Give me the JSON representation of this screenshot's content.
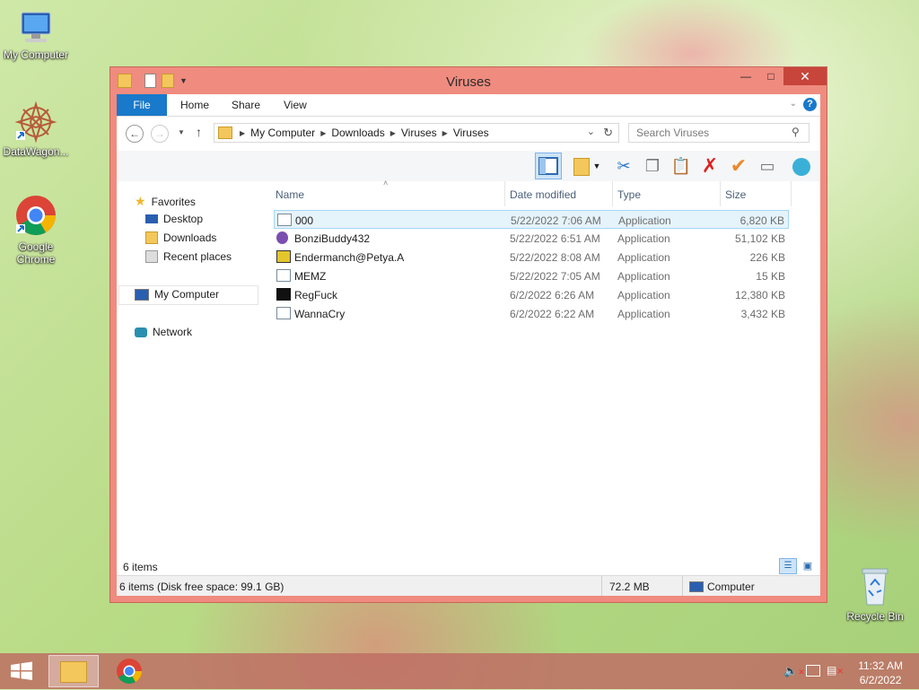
{
  "desktop": {
    "icons": [
      {
        "label": "My Computer"
      },
      {
        "label": "DataWagon..."
      },
      {
        "label": "Google Chrome"
      },
      {
        "label": "Recycle Bin"
      }
    ]
  },
  "window": {
    "title": "Viruses",
    "ribbon_tabs": [
      "File",
      "Home",
      "Share",
      "View"
    ],
    "breadcrumb": [
      "My Computer",
      "Downloads",
      "Viruses",
      "Viruses"
    ],
    "search_placeholder": "Search Viruses",
    "nav": {
      "favorites": "Favorites",
      "desktop": "Desktop",
      "downloads": "Downloads",
      "recent": "Recent places",
      "my_computer": "My Computer",
      "network": "Network"
    },
    "columns": {
      "name": "Name",
      "date": "Date modified",
      "type": "Type",
      "size": "Size"
    },
    "files": [
      {
        "name": "000",
        "date": "5/22/2022 7:06 AM",
        "type": "Application",
        "size": "6,820 KB"
      },
      {
        "name": "BonziBuddy432",
        "date": "5/22/2022 6:51 AM",
        "type": "Application",
        "size": "51,102 KB"
      },
      {
        "name": "Endermanch@Petya.A",
        "date": "5/22/2022 8:08 AM",
        "type": "Application",
        "size": "226 KB"
      },
      {
        "name": "MEMZ",
        "date": "5/22/2022 7:05 AM",
        "type": "Application",
        "size": "15 KB"
      },
      {
        "name": "RegFuck",
        "date": "6/2/2022 6:26 AM",
        "type": "Application",
        "size": "12,380 KB"
      },
      {
        "name": "WannaCry",
        "date": "6/2/2022 6:22 AM",
        "type": "Application",
        "size": "3,432 KB"
      }
    ],
    "item_count": "6 items",
    "status_left": "6 items (Disk free space: 99.1 GB)",
    "status_size": "72.2 MB",
    "status_location": "Computer"
  },
  "taskbar": {
    "time": "11:32 AM",
    "date": "6/2/2022"
  },
  "colors": {
    "window_frame": "#ef8b7f",
    "close_button": "#c7453a",
    "file_tab": "#1979ca",
    "selection": "#e5f3fb"
  }
}
